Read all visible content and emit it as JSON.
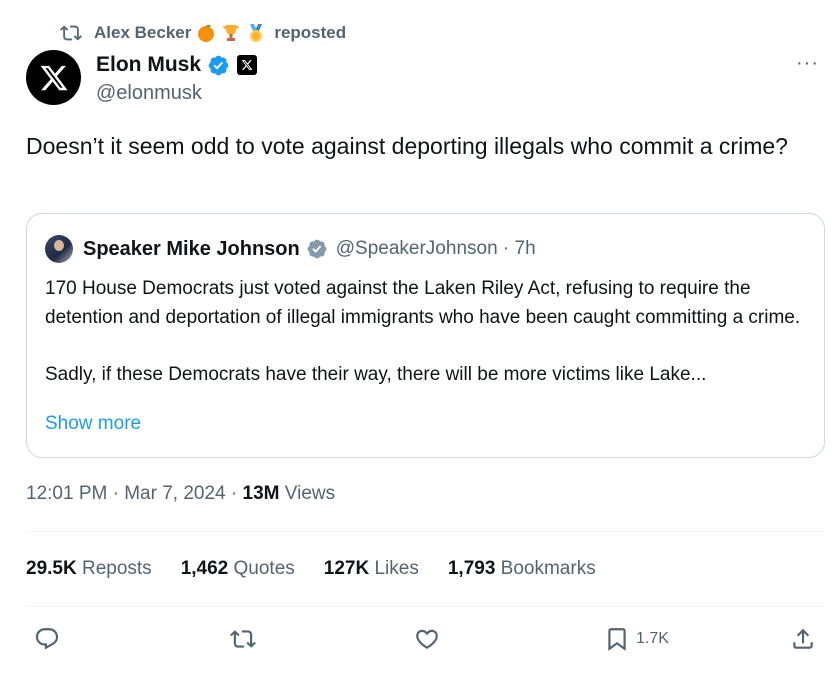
{
  "repost": {
    "name": "Alex Becker",
    "suffix": "reposted",
    "emojis": [
      "orange",
      "trophy",
      "medal"
    ]
  },
  "author": {
    "name": "Elon Musk",
    "handle": "@elonmusk",
    "verified": true
  },
  "more_label": "···",
  "tweet": {
    "text": "Doesn’t it seem odd to vote against deporting illegals who commit a crime?"
  },
  "quote": {
    "name": "Speaker Mike Johnson",
    "handle": "@SpeakerJohnson",
    "separator": "·",
    "time": "7h",
    "body": "170 House Democrats just voted against the Laken Riley Act, refusing to require the detention and deportation of illegal immigrants who have been caught committing a crime.\n\nSadly, if these Democrats have their way, there will be more victims like Lake...",
    "show_more": "Show more"
  },
  "meta": {
    "time": "12:01 PM",
    "dot1": "·",
    "date": "Mar 7, 2024",
    "dot2": "·",
    "views_count": "13M",
    "views_label": "Views"
  },
  "stats": [
    {
      "num": "29.5K",
      "label": "Reposts"
    },
    {
      "num": "1,462",
      "label": "Quotes"
    },
    {
      "num": "127K",
      "label": "Likes"
    },
    {
      "num": "1,793",
      "label": "Bookmarks"
    }
  ],
  "actions": {
    "bookmark_count": "1.7K"
  },
  "colors": {
    "accent": "#1d9bf0",
    "text": "#0f1419",
    "secondary": "#536471",
    "border": "#cfd9de",
    "divider": "#eff3f4"
  }
}
